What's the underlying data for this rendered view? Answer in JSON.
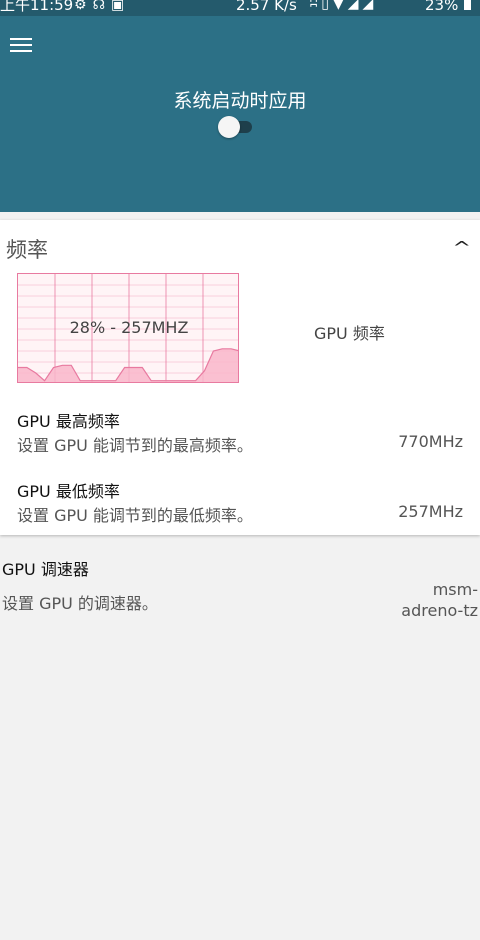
{
  "status_bar": {
    "time": "上午11:59",
    "left_icons": [
      "settings-icon",
      "headset-icon",
      "vpn-icon"
    ],
    "net_speed": "2.57 K/s",
    "right_icons": [
      "bluetooth-icon",
      "vibrate-icon",
      "wifi-icon",
      "signal-icon"
    ],
    "battery": "23%"
  },
  "header": {
    "menu_icon": "menu-icon",
    "boot_apply_label": "系统启动时应用",
    "boot_apply_enabled": false,
    "colors": {
      "header_bg": "#2c7086",
      "status_bg": "#245a6c"
    }
  },
  "frequency_card": {
    "title": "频率",
    "collapse_icon": "chevron-up-icon",
    "graph": {
      "label": "28% - 257MHZ",
      "side_label": "GPU 频率",
      "load_history_percent": [
        15,
        15,
        10,
        3,
        15,
        17,
        17,
        3,
        3,
        3,
        3,
        3,
        15,
        15,
        15,
        3,
        3,
        3,
        3,
        3,
        3,
        12,
        30,
        32,
        32,
        30
      ],
      "colors": {
        "fill": "#f9b6ca",
        "stroke": "#e87aa0"
      }
    },
    "max_freq": {
      "title": "GPU 最高频率",
      "subtitle": "设置 GPU 能调节到的最高频率。",
      "value": "770MHz"
    },
    "min_freq": {
      "title": "GPU 最低频率",
      "subtitle": "设置 GPU 能调节到的最低频率。",
      "value": "257MHz"
    }
  },
  "governor": {
    "title": "GPU 调速器",
    "subtitle": "设置 GPU 的调速器。",
    "value_line1": "msm-",
    "value_line2": "adreno-tz"
  }
}
